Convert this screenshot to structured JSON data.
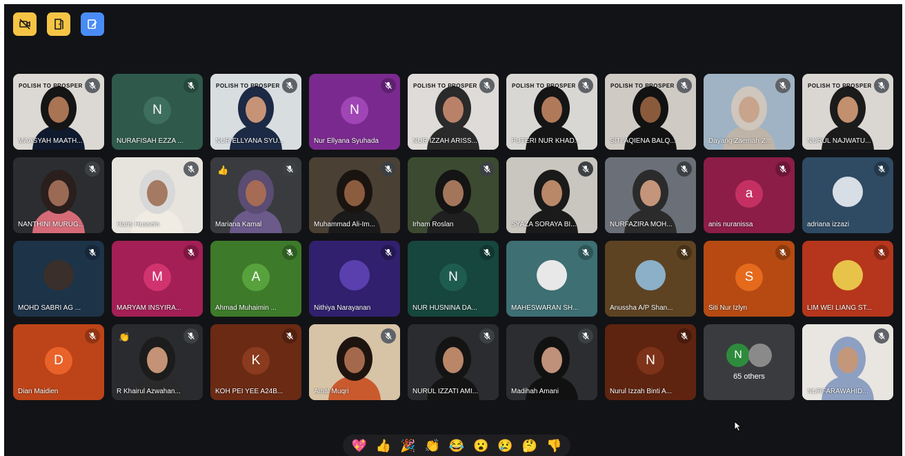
{
  "top_controls": [
    {
      "name": "camera-off-icon",
      "bg": "#f6c445"
    },
    {
      "name": "door-icon",
      "bg": "#f6c445"
    },
    {
      "name": "whiteboard-icon",
      "bg": "#4a8cf6"
    }
  ],
  "participants": [
    {
      "name": "MAASYAH MAATH...",
      "kind": "photo",
      "bg": "#dcd8d3",
      "skin": "#a97454",
      "hair": "#151515",
      "clothes": "#0f1a2e",
      "banner": "POLISH TO PROSPER",
      "mic_bg": "#5f6368"
    },
    {
      "name": "NURAFISAH EZZA ...",
      "kind": "letter",
      "letter": "N",
      "bg": "#2f5a4b",
      "avatar": "#3e6e5d",
      "mic_bg": "#24483b"
    },
    {
      "name": "NUR ELLYANA SYU...",
      "kind": "photo",
      "bg": "#d8dde0",
      "skin": "#c69377",
      "hair": "#1d2a45",
      "clothes": "#1d2a45",
      "banner": "POLISH TO PROSPER",
      "mic_bg": "#5f6368"
    },
    {
      "name": "Nur Ellyana Syuhada",
      "kind": "letter",
      "letter": "N",
      "bg": "#7a2a8e",
      "avatar": "#9f45b5",
      "mic_bg": "#5e1f70"
    },
    {
      "name": "NUR IZZAH ARISS...",
      "kind": "photo",
      "bg": "#dedbd8",
      "skin": "#b98168",
      "hair": "#2a2a2a",
      "clothes": "#2a2a2a",
      "banner": "POLISH TO PROSPER",
      "mic_bg": "#5f6368"
    },
    {
      "name": "PUTERI NUR KHAD...",
      "kind": "photo",
      "bg": "#d9d7d4",
      "skin": "#b07a5a",
      "hair": "#151515",
      "clothes": "#151515",
      "banner": "POLISH TO PROSPER",
      "mic_bg": "#5f6368"
    },
    {
      "name": "SITI AQIENA BALQ...",
      "kind": "photo",
      "bg": "#cfcac4",
      "skin": "#8a5a3c",
      "hair": "#121212",
      "clothes": "#121212",
      "banner": "POLISH TO PROSPER",
      "mic_bg": "#5f6368"
    },
    {
      "name": "Dayang Zaemah Z...",
      "kind": "photo",
      "bg": "#9fb3c4",
      "skin": "#c7a48b",
      "hair": "#cfc6bd",
      "clothes": "#bfb4a8",
      "banner": "",
      "mic_bg": "#5f6368"
    },
    {
      "name": "NURUL NAJWATU...",
      "kind": "photo",
      "bg": "#dad7d3",
      "skin": "#c2906e",
      "hair": "#1b1b1b",
      "clothes": "#1b1b1b",
      "banner": "POLISH TO PROSPER",
      "mic_bg": "#5f6368"
    },
    {
      "name": "NANTHINI MURUG...",
      "kind": "photo",
      "bg": "#2b2d31",
      "skin": "#9a6a55",
      "hair": "#2a1f1c",
      "clothes": "#d66b78",
      "banner": "",
      "mic_bg": "#3c4043"
    },
    {
      "name": "Haris Hussein",
      "kind": "photo",
      "bg": "#e7e4de",
      "skin": "#a47a62",
      "hair": "#d8d8d8",
      "clothes": "#f0ece4",
      "banner": "",
      "mic_bg": "#5f6368"
    },
    {
      "name": "Mariana Kamal",
      "kind": "photo",
      "bg": "#3a3b3e",
      "skin": "#a56b54",
      "hair": "#5a4c73",
      "clothes": "#6b5a8a",
      "banner": "",
      "mic_bg": "#3c4043",
      "hand": "👍"
    },
    {
      "name": "Muhammad Ali-Im...",
      "kind": "photo",
      "bg": "#4a4034",
      "skin": "#8c5c3f",
      "hair": "#1a1410",
      "clothes": "#1a1a1a",
      "banner": "",
      "mic_bg": "#3c4043"
    },
    {
      "name": "Irham Roslan",
      "kind": "photo",
      "bg": "#3b4a30",
      "skin": "#a3755b",
      "hair": "#141414",
      "clothes": "#1f1f1f",
      "banner": "",
      "mic_bg": "#3c4043"
    },
    {
      "name": "SYAZA SORAYA BI...",
      "kind": "photo",
      "bg": "#c9c6bf",
      "skin": "#b88868",
      "hair": "#1a1a1a",
      "clothes": "#1a1a1a",
      "banner": "",
      "mic_bg": "#3c4043"
    },
    {
      "name": "NURFAZIRA MOH...",
      "kind": "photo",
      "bg": "#6a6f78",
      "skin": "#c4957a",
      "hair": "#2b2b2b",
      "clothes": "#2b2b2b",
      "banner": "",
      "mic_bg": "#3c4043"
    },
    {
      "name": "anis nuranissa",
      "kind": "letter",
      "letter": "a",
      "bg": "#8c1d46",
      "avatar": "#c53063",
      "mic_bg": "#6d1636"
    },
    {
      "name": "adriana izzazi",
      "kind": "photo-avatar",
      "bg": "#2f4b64",
      "avatar": "#d8dee6",
      "mic_bg": "#23384b"
    },
    {
      "name": "MOHD SABRI AG ...",
      "kind": "photo-avatar",
      "bg": "#1d3348",
      "avatar": "#3a2f2a",
      "mic_bg": "#16273a"
    },
    {
      "name": "MARYAM INSYIRA...",
      "kind": "letter",
      "letter": "M",
      "bg": "#a31f55",
      "avatar": "#d1336f",
      "mic_bg": "#7d1841"
    },
    {
      "name": "Ahmad Muhaimin ...",
      "kind": "letter",
      "letter": "A",
      "bg": "#3d7a2a",
      "avatar": "#58a23d",
      "mic_bg": "#2f5e20"
    },
    {
      "name": "Nithiya Narayanan",
      "kind": "photo-avatar",
      "bg": "#30206e",
      "avatar": "#5a3fae",
      "mic_bg": "#241852"
    },
    {
      "name": "NUR HUSNINA DA...",
      "kind": "letter",
      "letter": "N",
      "bg": "#16463d",
      "avatar": "#1f5c50",
      "mic_bg": "#113630"
    },
    {
      "name": "MAHESWARAN SH...",
      "kind": "photo-avatar",
      "bg": "#3d6f73",
      "avatar": "#e8e8e8",
      "mic_bg": "#2e5558"
    },
    {
      "name": "Anussha A/P Shan...",
      "kind": "photo-avatar",
      "bg": "#5e4322",
      "avatar": "#8bb0c8",
      "mic_bg": "#473218"
    },
    {
      "name": "Siti Nur Izlyn",
      "kind": "letter",
      "letter": "S",
      "bg": "#b64a12",
      "avatar": "#e56a1c",
      "mic_bg": "#8c390d"
    },
    {
      "name": "LIM WEI LIANG ST...",
      "kind": "photo-avatar",
      "bg": "#b5361c",
      "avatar": "#e8c34a",
      "mic_bg": "#8a2915"
    },
    {
      "name": "Dian Maidien",
      "kind": "letter",
      "letter": "D",
      "bg": "#bd4418",
      "avatar": "#e9622a",
      "mic_bg": "#913413"
    },
    {
      "name": "R Khairul Azwahan...",
      "kind": "photo",
      "bg": "#2a2b2e",
      "skin": "#c49276",
      "hair": "#1c1c1c",
      "clothes": "#2a2a2a",
      "banner": "",
      "mic_bg": "#3c4043",
      "hand": "👏"
    },
    {
      "name": "KOH PEI YEE A24B...",
      "kind": "letter",
      "letter": "K",
      "bg": "#6b2a14",
      "avatar": "#8a3a1e",
      "mic_bg": "#52200f"
    },
    {
      "name": "Amal Muqri",
      "kind": "photo",
      "bg": "#d7c3a6",
      "skin": "#a4694d",
      "hair": "#1e140f",
      "clothes": "#c95a2e",
      "banner": "",
      "mic_bg": "#5f6368"
    },
    {
      "name": "NURUL IZZATI AMI...",
      "kind": "photo",
      "bg": "#2b2c2f",
      "skin": "#b98668",
      "hair": "#141414",
      "clothes": "#141414",
      "banner": "",
      "mic_bg": "#3c4043"
    },
    {
      "name": "Madihah Amani",
      "kind": "photo",
      "bg": "#2c2d30",
      "skin": "#c0917a",
      "hair": "#111111",
      "clothes": "#111111",
      "banner": "",
      "mic_bg": "#3c4043"
    },
    {
      "name": "Nurul Izzah Binti A...",
      "kind": "letter",
      "letter": "N",
      "bg": "#5f2410",
      "avatar": "#7d3319",
      "mic_bg": "#481b0c"
    },
    {
      "name": "65 others",
      "kind": "others",
      "bg": "#3a3b3e",
      "letter": "N",
      "avatar": "#2e8b3d",
      "mic_bg": "#3a3b3e"
    },
    {
      "name": "NURFARAWAHID...",
      "kind": "photo",
      "bg": "#e9e6e1",
      "skin": "#c4967a",
      "hair": "#8da0c2",
      "clothes": "#8da0c2",
      "banner": "",
      "mic_bg": "#5f6368",
      "active": true
    }
  ],
  "reactions": [
    "💖",
    "👍",
    "🎉",
    "👏",
    "😂",
    "😮",
    "😢",
    "🤔",
    "👎"
  ]
}
